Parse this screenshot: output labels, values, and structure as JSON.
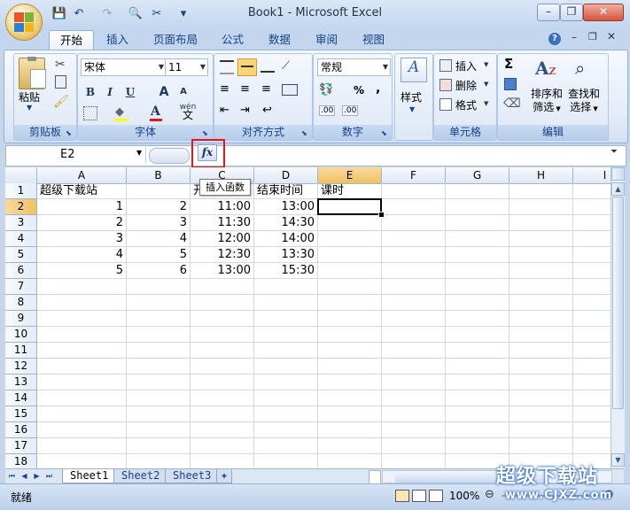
{
  "window": {
    "title": "Book1 - Microsoft Excel",
    "minimize": "–",
    "restore": "❐",
    "close": "✕"
  },
  "qat": {
    "save": "💾",
    "undo": "↶",
    "redo": "↷",
    "preview": "🔍",
    "tools": "✂",
    "more": "▾"
  },
  "tabs": [
    "开始",
    "插入",
    "页面布局",
    "公式",
    "数据",
    "审阅",
    "视图"
  ],
  "ribbon": {
    "clipboard": {
      "label": "剪贴板",
      "paste": "粘贴"
    },
    "font": {
      "label": "字体",
      "name": "宋体",
      "size": "11",
      "bold": "B",
      "italic": "I",
      "underline": "U",
      "grow": "A",
      "shrink": "A",
      "wen": "wén"
    },
    "alignment": {
      "label": "对齐方式"
    },
    "number": {
      "label": "数字",
      "format": "常规",
      "percent": "%",
      "comma": ",",
      "inc_decimal": ".00→.0",
      "dec_decimal": ".00"
    },
    "styles": {
      "label": "样式"
    },
    "cells": {
      "label": "单元格",
      "insert": "插入",
      "delete": "删除",
      "format": "格式"
    },
    "editing": {
      "label": "编辑",
      "sort": "排序和\n筛选",
      "sort_1": "排序和",
      "sort_2": "筛选",
      "find_1": "查找和",
      "find_2": "选择"
    }
  },
  "formula_bar": {
    "name_box": "E2",
    "fx": "fx",
    "tooltip": "插入函数",
    "content": ""
  },
  "sheet": {
    "columns": [
      "A",
      "B",
      "C",
      "D",
      "E",
      "F",
      "G",
      "H",
      "I"
    ],
    "rows": [
      "1",
      "2",
      "3",
      "4",
      "5",
      "6",
      "7",
      "8",
      "9",
      "10",
      "11",
      "12",
      "13",
      "14",
      "15",
      "16",
      "17",
      "18"
    ],
    "selected_cell": "E2",
    "cells": {
      "A1": "超级下载站",
      "C1": "开",
      "D1": "结束时间",
      "E1": "课时",
      "A2": "1",
      "B2": "2",
      "C2": "11:00",
      "D2": "13:00",
      "A3": "2",
      "B3": "3",
      "C3": "11:30",
      "D3": "14:30",
      "A4": "3",
      "B4": "4",
      "C4": "12:00",
      "D4": "14:00",
      "A5": "4",
      "B5": "5",
      "C5": "12:30",
      "D5": "13:30",
      "A6": "5",
      "B6": "6",
      "C6": "13:00",
      "D6": "15:30"
    }
  },
  "sheet_tabs": [
    "Sheet1",
    "Sheet2",
    "Sheet3"
  ],
  "status": {
    "ready": "就绪",
    "zoom": "100%"
  },
  "watermark": {
    "line1": "超级下载站",
    "line2": "www.CJXZ.com"
  },
  "colors": {
    "accent": "#15428b",
    "selection_header": "#f1c15f",
    "highlight": "#e01818"
  }
}
